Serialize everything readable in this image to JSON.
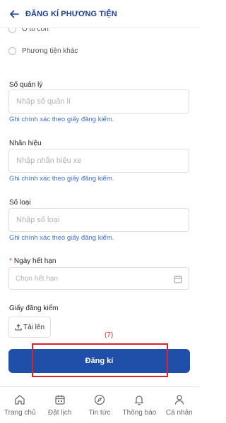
{
  "header": {
    "title": "ĐĂNG KÍ PHƯƠNG TIỆN"
  },
  "vehicle_types": [
    "Ô tô con",
    "Phương tiện khác"
  ],
  "fields": {
    "management_no": {
      "label": "Số quản lý",
      "placeholder": "Nhập số quản lí",
      "hint": "Ghi chính xác theo giấy đăng kiểm."
    },
    "brand": {
      "label": "Nhãn hiệu",
      "placeholder": "Nhập nhãn hiệu xe",
      "hint": "Ghi chính xác theo giấy đăng kiểm."
    },
    "model": {
      "label": "Số loại",
      "placeholder": "Nhập số loại",
      "hint": "Ghi chính xác theo giấy đăng kiểm."
    },
    "expiry": {
      "required_mark": "*",
      "label": "Ngày hết hạn",
      "placeholder": "Chọn hết hạn"
    },
    "certificate": {
      "label": "Giấy đăng kiểm",
      "upload_label": "Tải lên"
    }
  },
  "submit_label": "Đăng kí",
  "annotation": {
    "label": "(7)",
    "color": "#d9222a"
  },
  "tabs": [
    {
      "label": "Trang chủ",
      "icon": "home-icon"
    },
    {
      "label": "Đặt lịch",
      "icon": "calendar-icon"
    },
    {
      "label": "Tin tức",
      "icon": "compass-icon"
    },
    {
      "label": "Thông báo",
      "icon": "bell-icon"
    },
    {
      "label": "Cá nhân",
      "icon": "user-icon"
    }
  ],
  "colors": {
    "primary": "#1f4fa8",
    "hint": "#3d6fd4",
    "title": "#1a3d8f",
    "required": "#e0312c"
  }
}
